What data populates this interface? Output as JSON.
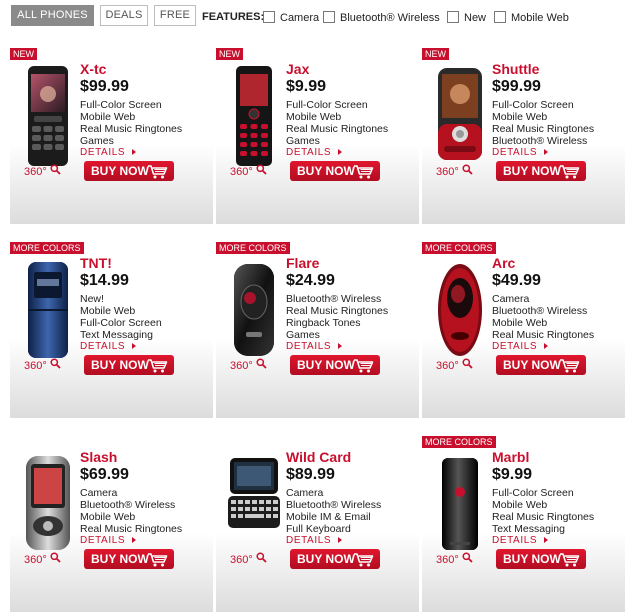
{
  "filters": {
    "tabs": [
      "ALL PHONES",
      "DEALS",
      "FREE"
    ],
    "features_label": "FEATURES:",
    "options": [
      "Camera",
      "Bluetooth® Wireless",
      "New",
      "Mobile Web"
    ]
  },
  "common": {
    "details": "DETAILS",
    "view360": "360°",
    "buy_now": "BUY NOW"
  },
  "colors": {
    "accent": "#c8102e"
  },
  "products": [
    {
      "badge": "NEW",
      "name": "X-tc",
      "price": "$99.99",
      "features": [
        "Full-Color Screen",
        "Mobile Web",
        "Real Music Ringtones",
        "Games"
      ]
    },
    {
      "badge": "NEW",
      "name": "Jax",
      "price": "$9.99",
      "features": [
        "Full-Color Screen",
        "Mobile Web",
        "Real Music Ringtones",
        "Games"
      ]
    },
    {
      "badge": "NEW",
      "name": "Shuttle",
      "price": "$99.99",
      "features": [
        "Full-Color Screen",
        "Mobile Web",
        "Real Music Ringtones",
        "Bluetooth® Wireless"
      ]
    },
    {
      "badge": "MORE COLORS",
      "name": "TNT!",
      "price": "$14.99",
      "features": [
        "New!",
        "Mobile Web",
        "Full-Color Screen",
        "Text Messaging"
      ]
    },
    {
      "badge": "MORE COLORS",
      "name": "Flare",
      "price": "$24.99",
      "features": [
        "Bluetooth® Wireless",
        "Real Music Ringtones",
        "Ringback Tones",
        "Games"
      ]
    },
    {
      "badge": "MORE COLORS",
      "name": "Arc",
      "price": "$49.99",
      "features": [
        "Camera",
        "Bluetooth® Wireless",
        "Mobile Web",
        "Real Music Ringtones"
      ]
    },
    {
      "badge": "",
      "name": "Slash",
      "price": "$69.99",
      "features": [
        "Camera",
        "Bluetooth® Wireless",
        "Mobile Web",
        "Real Music Ringtones"
      ]
    },
    {
      "badge": "",
      "name": "Wild Card",
      "price": "$89.99",
      "features": [
        "Camera",
        "Bluetooth® Wireless",
        "Mobile IM & Email",
        "Full Keyboard"
      ]
    },
    {
      "badge": "MORE COLORS",
      "name": "Marbl",
      "price": "$9.99",
      "features": [
        "Full-Color Screen",
        "Mobile Web",
        "Real Music Ringtones",
        "Text Messaging"
      ]
    }
  ]
}
